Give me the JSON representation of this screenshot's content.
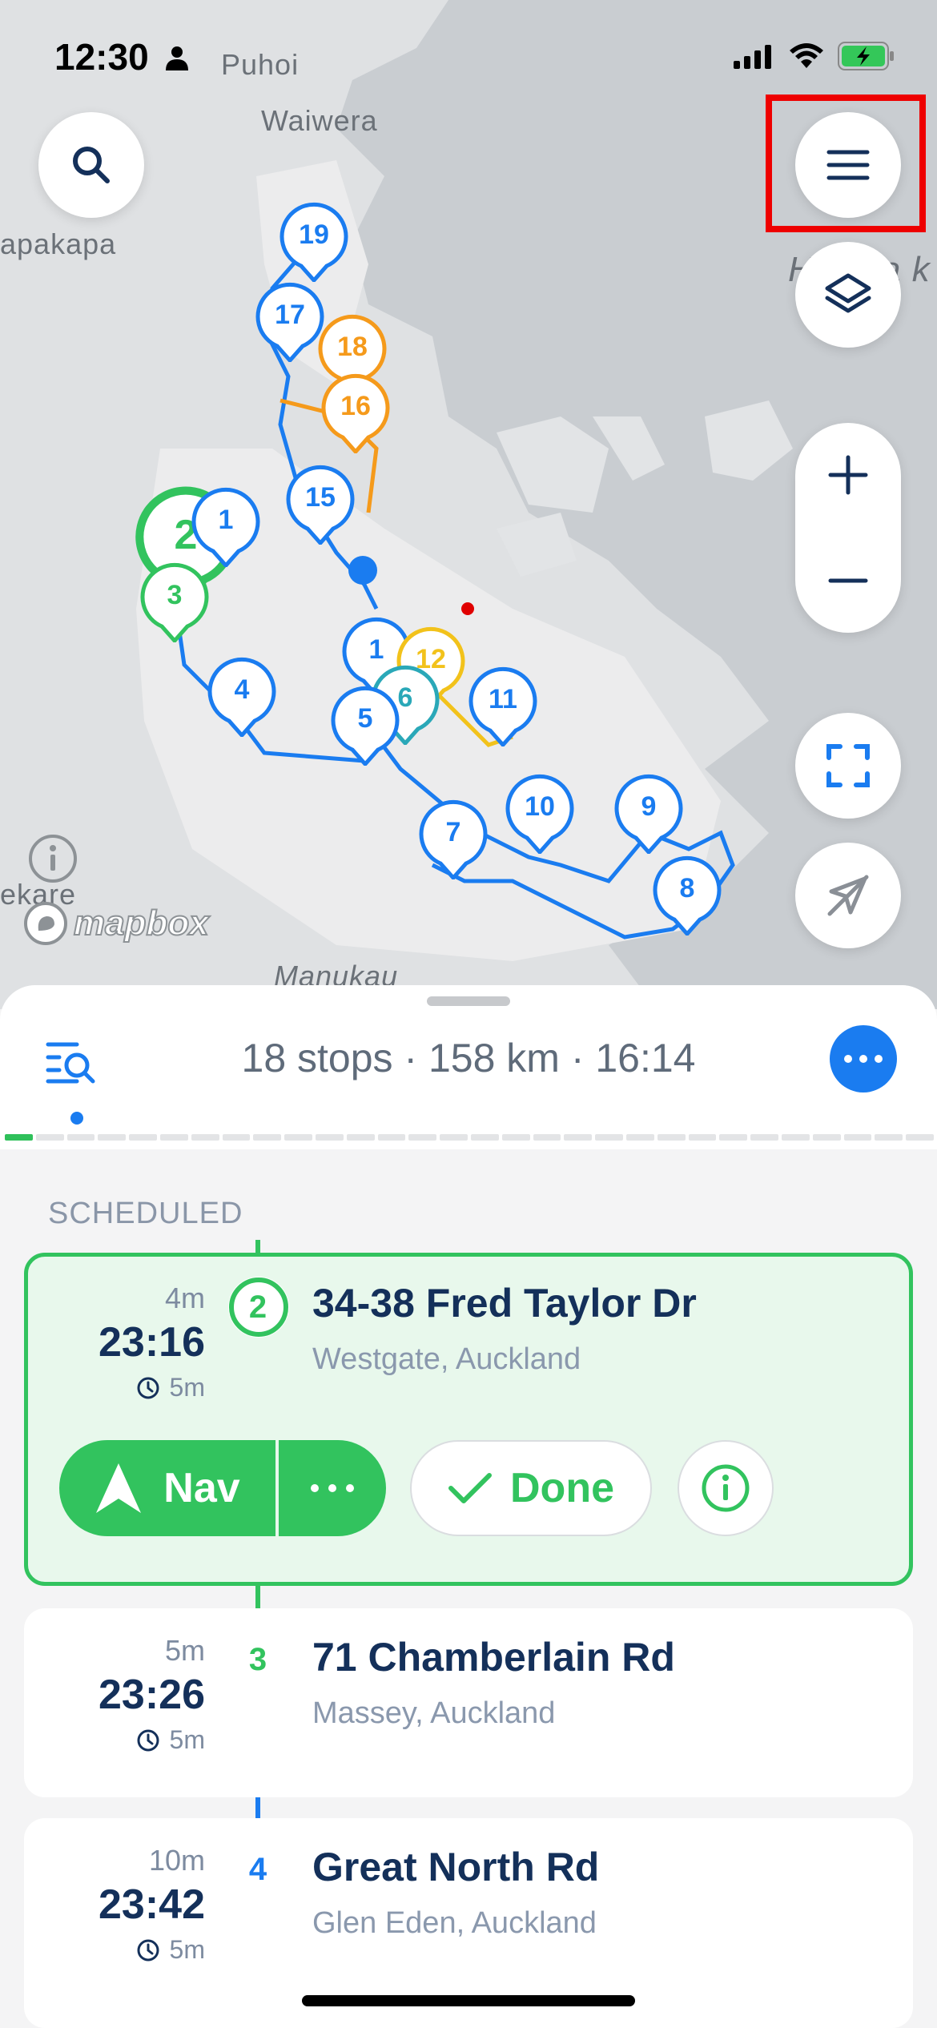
{
  "status_bar": {
    "time": "12:30"
  },
  "map": {
    "places": [
      "Puhoi",
      "Waiwera",
      "apakapa",
      "ekare",
      "Manukau",
      "H",
      "a k"
    ],
    "attribution": "mapbox",
    "pins": [
      {
        "label": "19",
        "color": "#1a7cf0"
      },
      {
        "label": "17",
        "color": "#1a7cf0"
      },
      {
        "label": "18",
        "color": "#f59a1b"
      },
      {
        "label": "16",
        "color": "#f59a1b"
      },
      {
        "label": "15",
        "color": "#1a7cf0"
      },
      {
        "label": "2",
        "color": "#32c35e"
      },
      {
        "label": "1",
        "color": "#1a7cf0"
      },
      {
        "label": "3",
        "color": "#32c35e"
      },
      {
        "label": "4",
        "color": "#1a7cf0"
      },
      {
        "label": "1",
        "color": "#1a7cf0"
      },
      {
        "label": "12",
        "color": "#f2c21b"
      },
      {
        "label": "6",
        "color": "#2aa8b8"
      },
      {
        "label": "5",
        "color": "#1a7cf0"
      },
      {
        "label": "11",
        "color": "#1a7cf0"
      },
      {
        "label": "10",
        "color": "#1a7cf0"
      },
      {
        "label": "9",
        "color": "#1a7cf0"
      },
      {
        "label": "7",
        "color": "#1a7cf0"
      },
      {
        "label": "8",
        "color": "#1a7cf0"
      }
    ],
    "controls": [
      "search-icon",
      "menu-icon",
      "layers-icon",
      "zoom-in-icon",
      "zoom-out-icon",
      "fullscreen-icon",
      "recenter-icon",
      "info-icon"
    ]
  },
  "sheet": {
    "summary": "18 stops · 158 km · 16:14",
    "section": "SCHEDULED",
    "stops": [
      {
        "number": "2",
        "mins": "4m",
        "time": "23:16",
        "dwell": "5m",
        "title": "34-38 Fred Taylor Dr",
        "subtitle": "Westgate, Auckland"
      },
      {
        "number": "3",
        "mins": "5m",
        "time": "23:26",
        "dwell": "5m",
        "title": "71 Chamberlain Rd",
        "subtitle": "Massey, Auckland"
      },
      {
        "number": "4",
        "mins": "10m",
        "time": "23:42",
        "dwell": "5m",
        "title": "Great North Rd",
        "subtitle": "Glen Eden, Auckland"
      }
    ],
    "actions": {
      "nav": "Nav",
      "done": "Done"
    }
  },
  "colors": {
    "accent_blue": "#1a7cf0",
    "green": "#32c35e",
    "orange": "#f59a1b",
    "navy": "#14305a"
  }
}
